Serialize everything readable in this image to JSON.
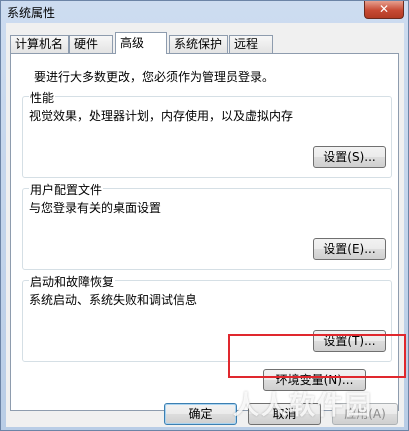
{
  "window": {
    "title": "系统属性",
    "close_label": "✕"
  },
  "tabs": [
    {
      "label": "计算机名"
    },
    {
      "label": "硬件"
    },
    {
      "label": "高级"
    },
    {
      "label": "系统保护"
    },
    {
      "label": "远程"
    }
  ],
  "panel": {
    "intro": "要进行大多数更改，您必须作为管理员登录。",
    "performance": {
      "title": "性能",
      "description": "视觉效果，处理器计划，内存使用，以及虚拟内存",
      "button": "设置(S)..."
    },
    "user_profiles": {
      "title": "用户配置文件",
      "description": "与您登录有关的桌面设置",
      "button": "设置(E)..."
    },
    "startup_recovery": {
      "title": "启动和故障恢复",
      "description": "系统启动、系统失败和调试信息",
      "button": "设置(T)..."
    },
    "env_button": "环境变量(N)..."
  },
  "footer": {
    "ok": "确定",
    "cancel": "取消",
    "apply": "应用(A)"
  },
  "watermark": "人人软件园",
  "colors": {
    "highlight_box": "#e0282e"
  }
}
